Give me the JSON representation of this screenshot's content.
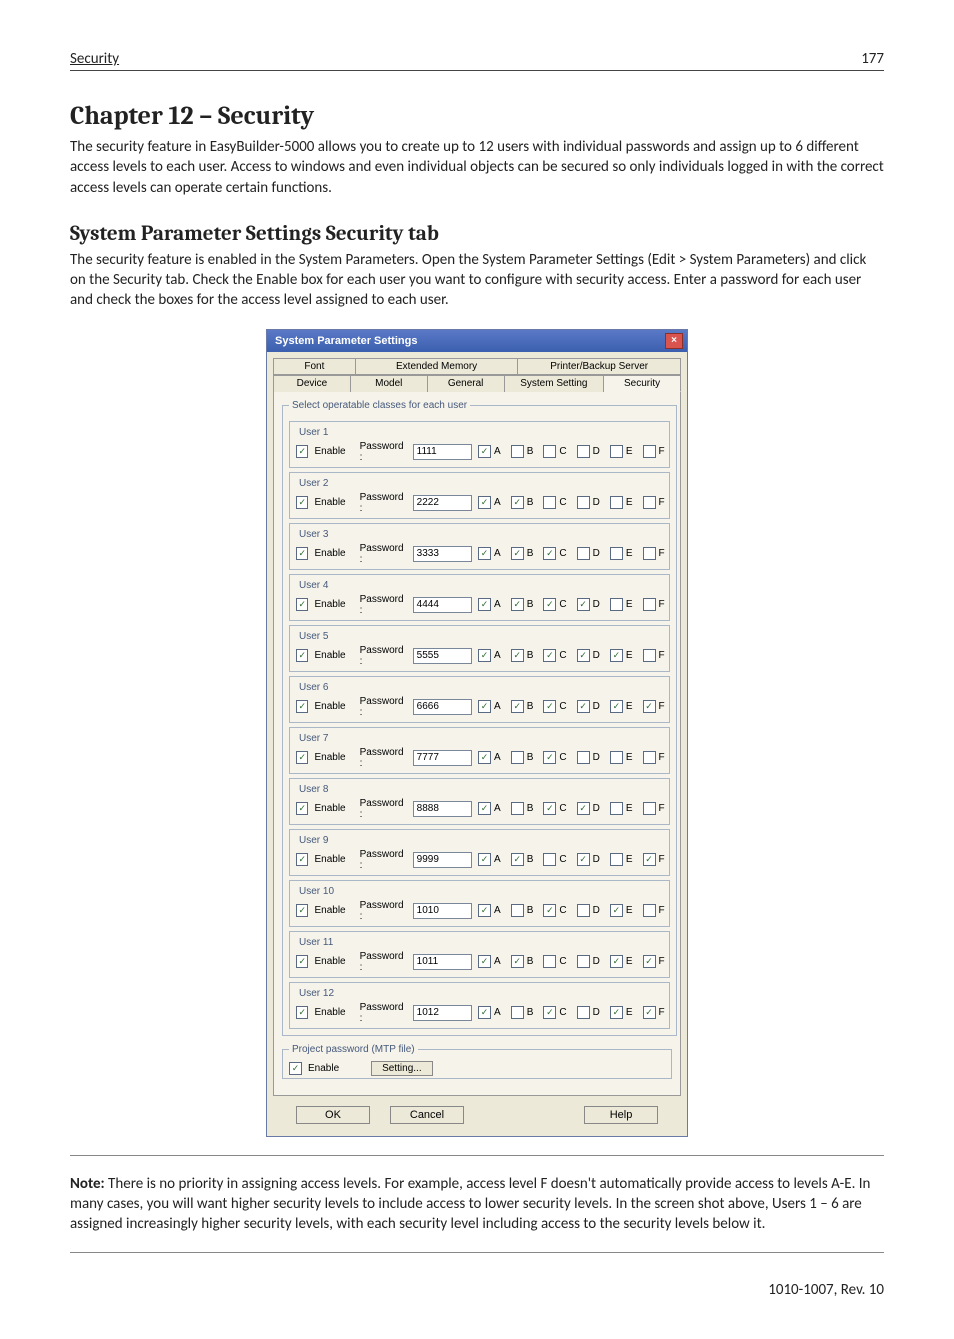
{
  "header": {
    "left": "Security",
    "page": "177"
  },
  "chapter_title": "Chapter 12 – Security",
  "intro": "The security feature in EasyBuilder-5000 allows you to create up to 12 users with individual passwords and assign up to 6 different access levels to each user. Access to windows and even individual objects can be secured so only individuals logged in with the correct access levels can operate certain functions.",
  "section_title": "System Parameter Settings Security tab",
  "section_body": "The security feature is enabled in the System Parameters. Open the System Parameter Settings (Edit > System Parameters) and click on the Security tab. Check the Enable box for each user you want to configure with security access. Enter a password for each user and check the boxes for the access level assigned to each user.",
  "note_label": "Note:",
  "note_body": " There is no priority in assigning access levels. For example, access level F doesn't automatically provide access to levels A-E. In many cases, you will want higher security levels to include access to lower security levels. In the screen shot above, Users 1 – 6 are assigned increasingly higher security levels, with each security level including access to the security levels below it.",
  "footer_rev": "1010-1007, Rev. 10",
  "dialog": {
    "title": "System Parameter Settings",
    "tabs_top": [
      "Font",
      "Extended Memory",
      "Printer/Backup Server"
    ],
    "tabs_bot": [
      "Device",
      "Model",
      "General",
      "System Setting",
      "Security"
    ],
    "active_tab": "Security",
    "group_legend": "Select operatable classes for each user",
    "enable_label": "Enable",
    "password_label": "Password :",
    "class_labels": [
      "A",
      "B",
      "C",
      "D",
      "E",
      "F"
    ],
    "users": [
      {
        "n": "User 1",
        "enable": true,
        "pw": "1111",
        "cls": [
          true,
          false,
          false,
          false,
          false,
          false
        ]
      },
      {
        "n": "User 2",
        "enable": true,
        "pw": "2222",
        "cls": [
          true,
          true,
          false,
          false,
          false,
          false
        ]
      },
      {
        "n": "User 3",
        "enable": true,
        "pw": "3333",
        "cls": [
          true,
          true,
          true,
          false,
          false,
          false
        ]
      },
      {
        "n": "User 4",
        "enable": true,
        "pw": "4444",
        "cls": [
          true,
          true,
          true,
          true,
          false,
          false
        ]
      },
      {
        "n": "User 5",
        "enable": true,
        "pw": "5555",
        "cls": [
          true,
          true,
          true,
          true,
          true,
          false
        ]
      },
      {
        "n": "User 6",
        "enable": true,
        "pw": "6666",
        "cls": [
          true,
          true,
          true,
          true,
          true,
          true
        ]
      },
      {
        "n": "User 7",
        "enable": true,
        "pw": "7777",
        "cls": [
          true,
          false,
          true,
          false,
          false,
          false
        ]
      },
      {
        "n": "User 8",
        "enable": true,
        "pw": "8888",
        "cls": [
          true,
          false,
          true,
          true,
          false,
          false
        ]
      },
      {
        "n": "User 9",
        "enable": true,
        "pw": "9999",
        "cls": [
          true,
          true,
          false,
          true,
          false,
          true
        ]
      },
      {
        "n": "User 10",
        "enable": true,
        "pw": "1010",
        "cls": [
          true,
          false,
          true,
          false,
          true,
          false
        ]
      },
      {
        "n": "User 11",
        "enable": true,
        "pw": "1011",
        "cls": [
          true,
          true,
          false,
          false,
          true,
          true
        ]
      },
      {
        "n": "User 12",
        "enable": true,
        "pw": "1012",
        "cls": [
          true,
          false,
          true,
          false,
          true,
          true
        ]
      }
    ],
    "project_pw_legend": "Project password (MTP file)",
    "project_pw_enable": true,
    "setting_btn": "Setting...",
    "ok": "OK",
    "cancel": "Cancel",
    "help": "Help"
  }
}
